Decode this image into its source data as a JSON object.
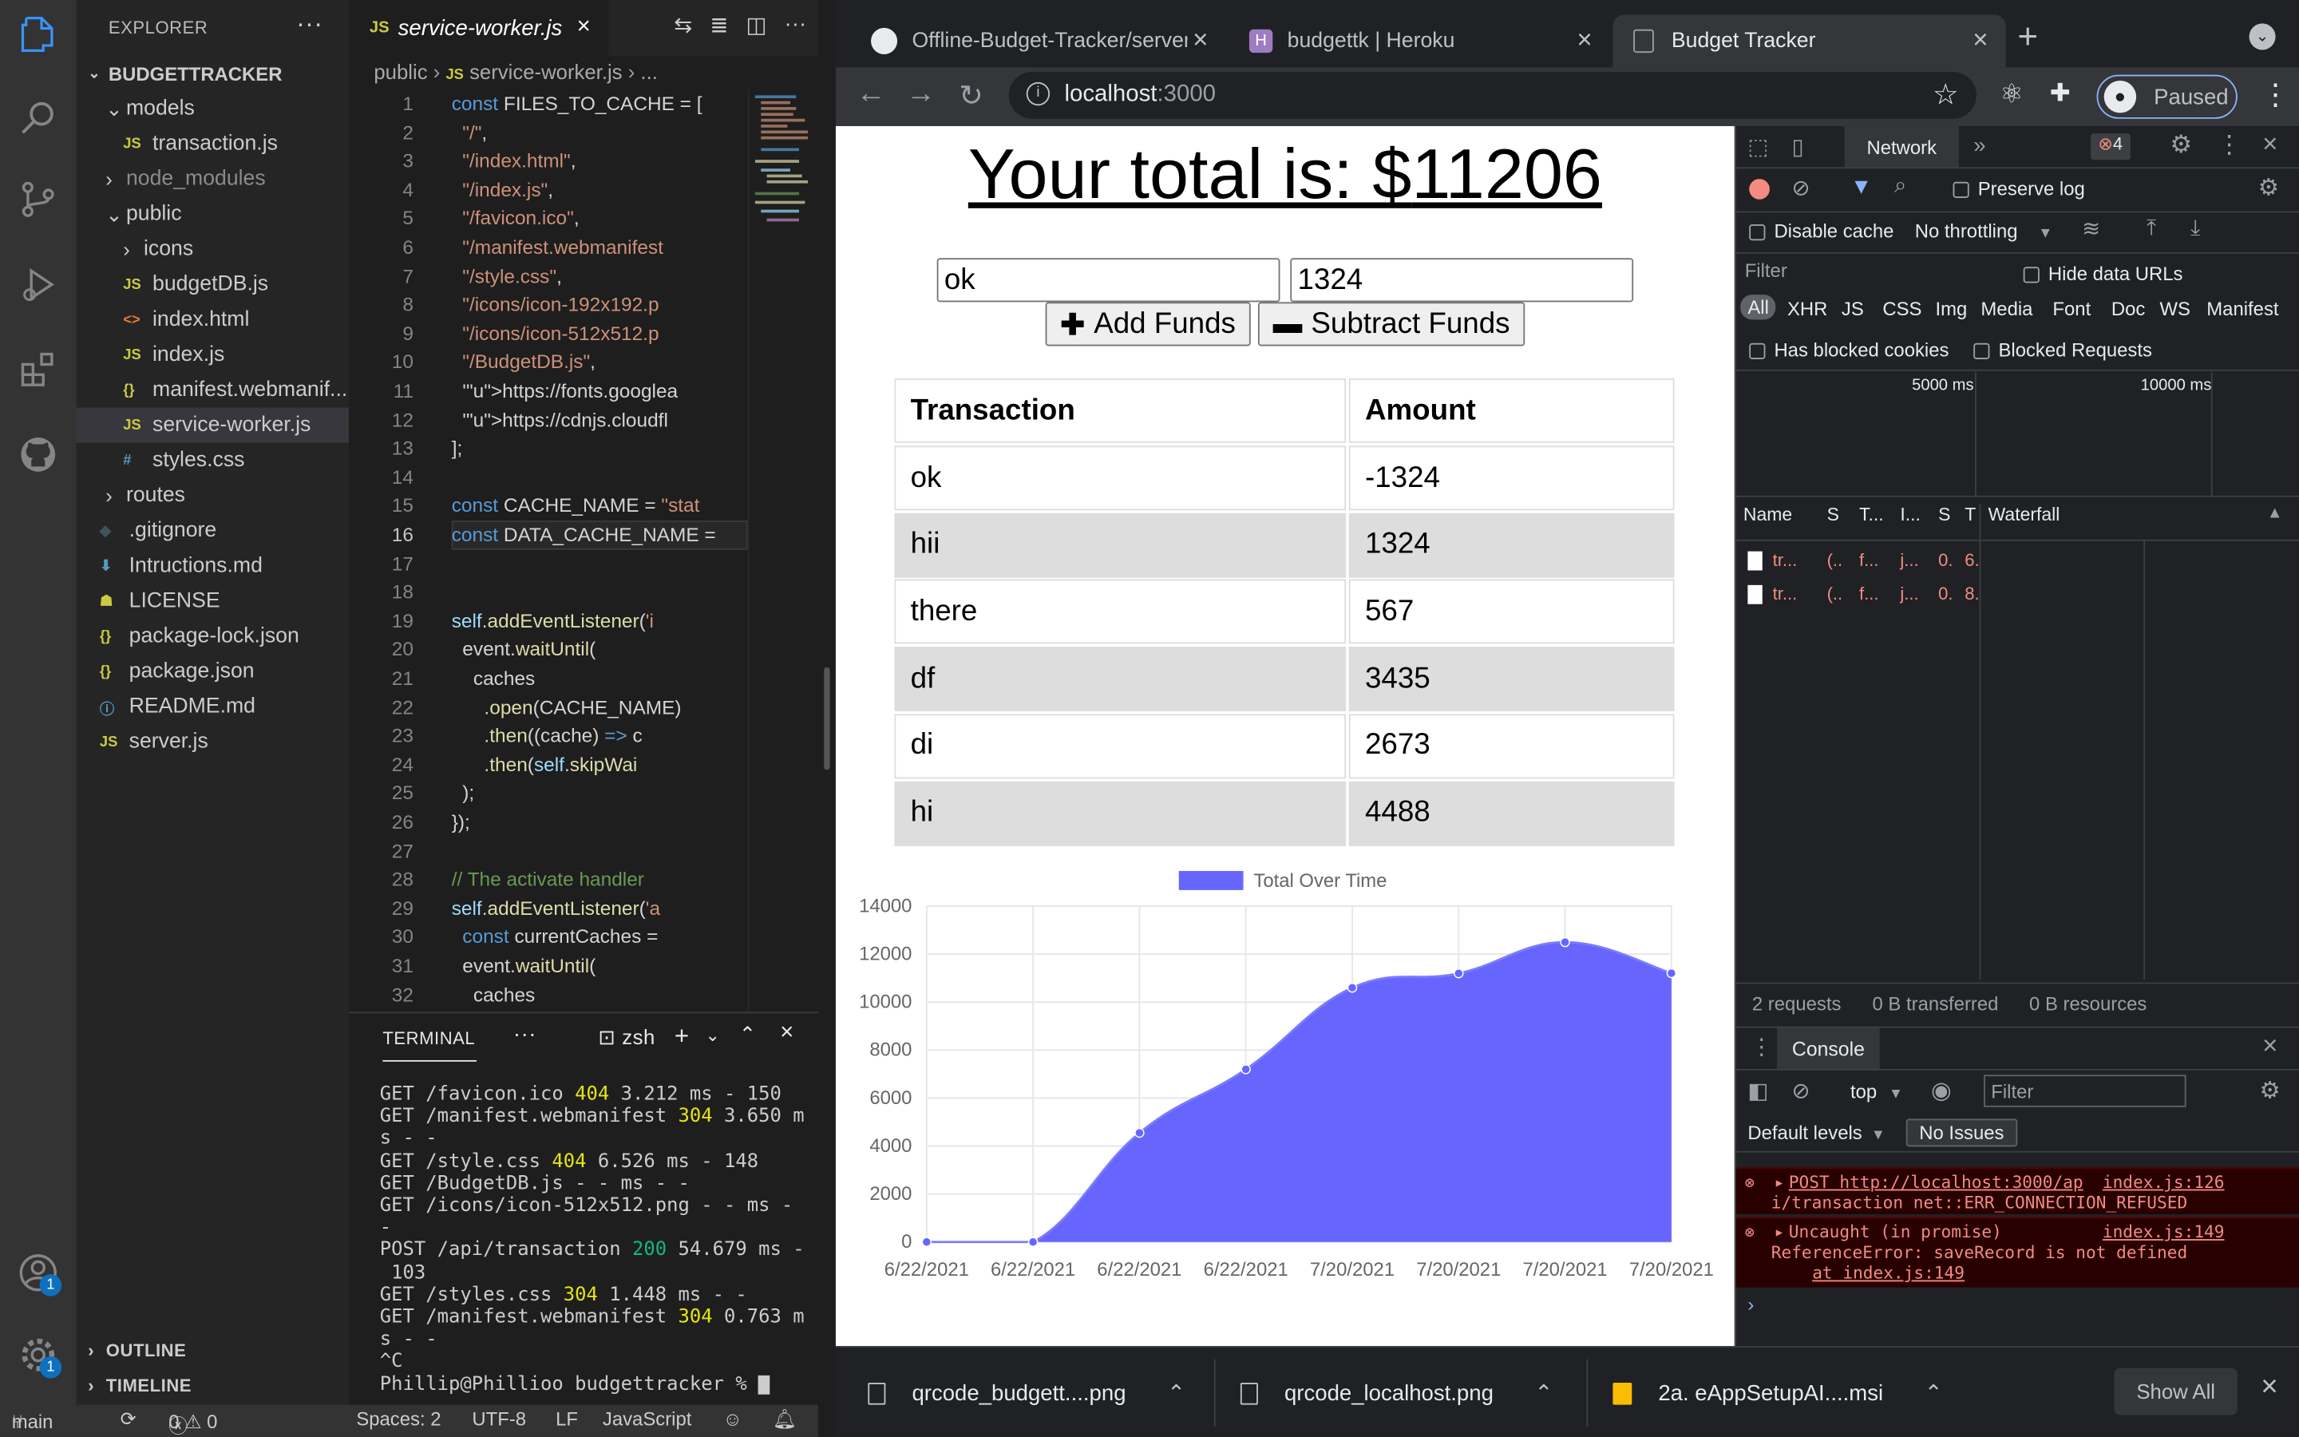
{
  "vscode": {
    "explorer_title": "EXPLORER",
    "project": "BUDGETTRACKER",
    "tree": [
      {
        "label": "models",
        "type": "folder",
        "open": true,
        "depth": 1
      },
      {
        "label": "transaction.js",
        "type": "js",
        "depth": 2
      },
      {
        "label": "node_modules",
        "type": "folder",
        "open": false,
        "depth": 1,
        "dim": true
      },
      {
        "label": "public",
        "type": "folder",
        "open": true,
        "depth": 1
      },
      {
        "label": "icons",
        "type": "folder",
        "open": false,
        "depth": 2
      },
      {
        "label": "budgetDB.js",
        "type": "js",
        "depth": 2
      },
      {
        "label": "index.html",
        "type": "html",
        "depth": 2
      },
      {
        "label": "index.js",
        "type": "js",
        "depth": 2
      },
      {
        "label": "manifest.webmanif...",
        "type": "json",
        "depth": 2
      },
      {
        "label": "service-worker.js",
        "type": "js",
        "depth": 2,
        "selected": true
      },
      {
        "label": "styles.css",
        "type": "css",
        "depth": 2
      },
      {
        "label": "routes",
        "type": "folder",
        "open": false,
        "depth": 1
      },
      {
        "label": ".gitignore",
        "type": "git",
        "depth": 1
      },
      {
        "label": "Intructions.md",
        "type": "md",
        "depth": 1
      },
      {
        "label": "LICENSE",
        "type": "license",
        "depth": 1
      },
      {
        "label": "package-lock.json",
        "type": "json",
        "depth": 1
      },
      {
        "label": "package.json",
        "type": "json",
        "depth": 1
      },
      {
        "label": "README.md",
        "type": "info",
        "depth": 1
      },
      {
        "label": "server.js",
        "type": "js",
        "depth": 1
      }
    ],
    "outline": "OUTLINE",
    "timeline": "TIMELINE",
    "tab_label": "service-worker.js",
    "breadcrumb": [
      "public",
      "service-worker.js",
      "..."
    ],
    "current_line": 16,
    "code_lines": [
      "const FILES_TO_CACHE = [",
      "  \"/\",",
      "  \"/index.html\",",
      "  \"/index.js\",",
      "  \"/favicon.ico\",",
      "  \"/manifest.webmanifest",
      "  \"/style.css\",",
      "  \"/icons/icon-192x192.p",
      "  \"/icons/icon-512x512.p",
      "  \"/BudgetDB.js\",",
      "  'https://fonts.googlea",
      "  'https://cdnjs.cloudfl",
      "];",
      "",
      "const CACHE_NAME = \"stat",
      "const DATA_CACHE_NAME = ",
      "",
      "",
      "self.addEventListener('i",
      "  event.waitUntil(",
      "    caches",
      "      .open(CACHE_NAME)",
      "      .then((cache) => c",
      "      .then(self.skipWai",
      "  );",
      "});",
      "",
      "// The activate handler",
      "self.addEventListener('a",
      "  const currentCaches =",
      "  event.waitUntil(",
      "    caches"
    ],
    "terminal": {
      "tab": "TERMINAL",
      "shell": "zsh",
      "lines": [
        {
          "t": "GET /favicon.ico ",
          "code": "404",
          "rest": " 3.212 ms - 150"
        },
        {
          "t": "GET /manifest.webmanifest ",
          "code": "304",
          "rest": " 3.650 m"
        },
        {
          "t": "s - -",
          "code": "",
          "rest": ""
        },
        {
          "t": "GET /style.css ",
          "code": "404",
          "rest": " 6.526 ms - 148"
        },
        {
          "t": "GET /BudgetDB.js - - ms - -",
          "code": "",
          "rest": ""
        },
        {
          "t": "GET /icons/icon-512x512.png - - ms -",
          "code": "",
          "rest": ""
        },
        {
          "t": "-",
          "code": "",
          "rest": ""
        },
        {
          "t": "POST /api/transaction ",
          "code": "200",
          "rest": " 54.679 ms -"
        },
        {
          "t": " 103",
          "code": "",
          "rest": ""
        },
        {
          "t": "GET /styles.css ",
          "code": "304",
          "rest": " 1.448 ms - -"
        },
        {
          "t": "GET /manifest.webmanifest ",
          "code": "304",
          "rest": " 0.763 m"
        },
        {
          "t": "s - -",
          "code": "",
          "rest": ""
        },
        {
          "t": "^C",
          "code": "",
          "rest": ""
        },
        {
          "t": "Phillip@Phillioo budgettracker % ",
          "code": "",
          "rest": ""
        }
      ]
    },
    "status": {
      "branch": "main",
      "problems": "0 ⚠ 0",
      "spaces": "Spaces: 2",
      "encoding": "UTF-8",
      "eol": "LF",
      "language": "JavaScript"
    },
    "badges": {
      "accounts": "1",
      "settings": "1"
    }
  },
  "chrome": {
    "tabs": [
      {
        "title": "Offline-Budget-Tracker/server.",
        "icon": "github"
      },
      {
        "title": "budgettk | Heroku",
        "icon": "heroku"
      },
      {
        "title": "Budget Tracker",
        "icon": "page",
        "active": true
      }
    ],
    "url_host": "localhost",
    "url_port": ":3000",
    "profile": "Paused",
    "downloads": [
      {
        "name": "qrcode_budgett....png"
      },
      {
        "name": "qrcode_localhost.png"
      },
      {
        "name": "2a. eAppSetupAI....msi"
      }
    ],
    "show_all": "Show All"
  },
  "app": {
    "total_label": "Your total is: $",
    "total_value": "11206",
    "name_value": "ok",
    "amount_value": "1324",
    "add_button": "Add Funds",
    "subtract_button": "Subtract Funds",
    "table_headers": [
      "Transaction",
      "Amount"
    ],
    "transactions": [
      {
        "name": "ok",
        "amount": "-1324"
      },
      {
        "name": "hii",
        "amount": "1324"
      },
      {
        "name": "there",
        "amount": "567"
      },
      {
        "name": "df",
        "amount": "3435"
      },
      {
        "name": "di",
        "amount": "2673"
      },
      {
        "name": "hi",
        "amount": "4488"
      }
    ]
  },
  "chart_data": {
    "type": "area",
    "legend": "Total Over Time",
    "legend_position": "top",
    "categories": [
      "6/22/2021",
      "6/22/2021",
      "6/22/2021",
      "6/22/2021",
      "7/20/2021",
      "7/20/2021",
      "7/20/2021",
      "7/20/2021"
    ],
    "series": [
      {
        "name": "Total Over Time",
        "values": [
          0,
          0,
          4550,
          7200,
          10600,
          11200,
          12500,
          11206
        ],
        "color": "#6666ff"
      }
    ],
    "yticks": [
      "14000",
      "12000",
      "10000",
      "8000",
      "6000",
      "4000",
      "2000",
      "0"
    ],
    "ylim": [
      0,
      14000
    ],
    "grid": true
  },
  "devtools": {
    "active_tab": "Network",
    "error_count": "4",
    "preserve_log": "Preserve log",
    "disable_cache": "Disable cache",
    "throttling": "No throttling",
    "filter_placeholder": "Filter",
    "hide_data_urls": "Hide data URLs",
    "types": [
      "All",
      "XHR",
      "JS",
      "CSS",
      "Img",
      "Media",
      "Font",
      "Doc",
      "WS",
      "Manifest"
    ],
    "blocked_cookies": "Has blocked cookies",
    "blocked_requests": "Blocked Requests",
    "timeline_ticks": [
      "5000 ms",
      "10000 ms"
    ],
    "columns": [
      "Name",
      "S",
      "T...",
      "I...",
      "S",
      "T",
      "Waterfall"
    ],
    "requests": [
      {
        "name": "tr...",
        "s": "(..",
        "t": "f...",
        "i": "j...",
        "size": "0.",
        "time": "6."
      },
      {
        "name": "tr...",
        "s": "(..",
        "t": "f...",
        "i": "j...",
        "size": "0.",
        "time": "8."
      }
    ],
    "summary": [
      "2 requests",
      "0 B transferred",
      "0 B resources"
    ],
    "console_tab": "Console",
    "context": "top",
    "console_filter": "Filter",
    "levels": "Default levels",
    "issues": "No Issues",
    "errors": [
      {
        "line1": "POST http://localhost:3000/ap",
        "src": "index.js:126",
        "line2": "i/transaction net::ERR_CONNECTION_REFUSED"
      },
      {
        "line1": "Uncaught (in promise)",
        "src": "index.js:149",
        "line2": "ReferenceError: saveRecord is not defined",
        "line3": "at index.js:149"
      }
    ]
  }
}
